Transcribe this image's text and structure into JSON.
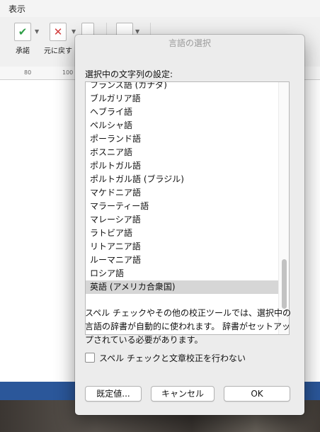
{
  "menubar": {
    "view": "表示"
  },
  "ribbon": {
    "accept_label": "承諾",
    "revert_label": "元に戻す"
  },
  "ruler": {
    "tick_80": "80",
    "tick_100": "100"
  },
  "dialog": {
    "title": "言語の選択",
    "prompt": "選択中の文字列の設定:",
    "languages": [
      "フランス語 (カナダ)",
      "ブルガリア語",
      "ヘブライ語",
      "ペルシャ語",
      "ポーランド語",
      "ボスニア語",
      "ポルトガル語",
      "ポルトガル語 (ブラジル)",
      "マケドニア語",
      "マラーティー語",
      "マレーシア語",
      "ラトビア語",
      "リトアニア語",
      "ルーマニア語",
      "ロシア語",
      "英語 (アメリカ合衆国)"
    ],
    "selected_language": "英語 (アメリカ合衆国)",
    "description": "スペル チェックやその他の校正ツールでは、選択中の言語の辞書が自動的に使われます。 辞書がセットアップされている必要があります。",
    "checkbox_label": "スペル チェックと文章校正を行わない",
    "checkbox_checked": false,
    "btn_defaults": "既定値...",
    "btn_cancel": "キャンセル",
    "btn_ok": "OK"
  },
  "colors": {
    "statusbar": "#2b579a",
    "selection": "#d6d6d6",
    "accept_check": "#2e9e47",
    "revert_x": "#d23b3b"
  }
}
